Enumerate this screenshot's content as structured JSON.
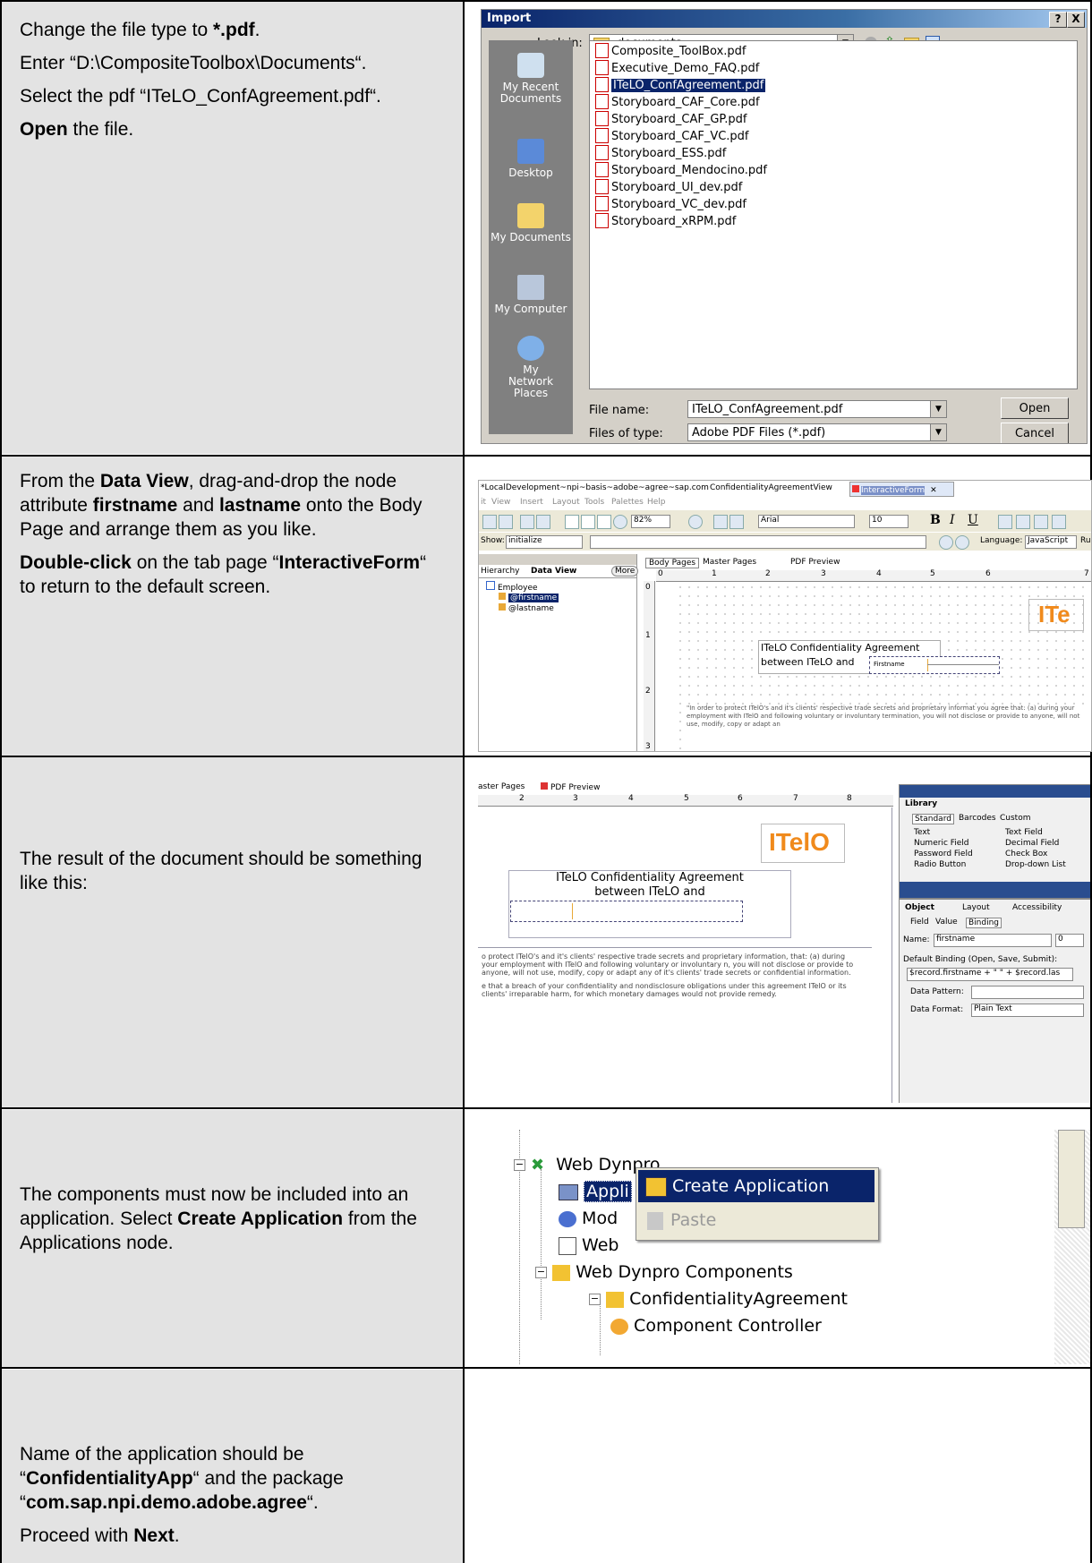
{
  "rows": [
    {
      "paragraphs": [
        [
          {
            "t": "Change the file type to "
          },
          {
            "t": "*.pdf",
            "b": true
          },
          {
            "t": "."
          }
        ],
        [
          {
            "t": "Enter “D:\\CompositeToolbox\\Documents“."
          }
        ],
        [
          {
            "t": "Select the pdf “ITeLO_ConfAgreement.pdf“."
          }
        ],
        [
          {
            "t": "Open",
            "b": true
          },
          {
            "t": " the file."
          }
        ]
      ]
    },
    {
      "paragraphs": [
        [
          {
            "t": "From the "
          },
          {
            "t": "Data View",
            "b": true
          },
          {
            "t": ", drag-and-drop the node attribute "
          },
          {
            "t": "firstname",
            "b": true
          },
          {
            "t": " and "
          },
          {
            "t": "lastname",
            "b": true
          },
          {
            "t": " onto the Body Page and arrange them as you like."
          }
        ],
        [
          {
            "t": "Double-click",
            "b": true
          },
          {
            "t": " on the tab page “"
          },
          {
            "t": "InteractiveForm",
            "b": true
          },
          {
            "t": "“ to return to the default screen."
          }
        ]
      ]
    },
    {
      "paragraphs": [
        [
          {
            "t": "The result of the document should be something like this:"
          }
        ]
      ]
    },
    {
      "paragraphs": [
        [
          {
            "t": "The components must now be included into an application. Select "
          },
          {
            "t": "Create Application",
            "b": true
          },
          {
            "t": " from the Applications node."
          }
        ]
      ]
    },
    {
      "paragraphs": [
        [
          {
            "t": "Name of the application should be “"
          },
          {
            "t": "ConfidentialityApp",
            "b": true
          },
          {
            "t": "“ and the package “"
          },
          {
            "t": "com.sap.npi.demo.adobe.agree",
            "b": true
          },
          {
            "t": "“."
          }
        ],
        [
          {
            "t": "Proceed with "
          },
          {
            "t": "Next",
            "b": true
          },
          {
            "t": "."
          }
        ]
      ]
    }
  ],
  "import_dialog": {
    "title": "Import",
    "title_buttons": [
      "?",
      "X"
    ],
    "look_in_label": "Look in:",
    "look_in_value": "documents",
    "places": [
      "My Recent Documents",
      "Desktop",
      "My Documents",
      "My Computer",
      "My Network Places"
    ],
    "files": [
      "Composite_ToolBox.pdf",
      "Executive_Demo_FAQ.pdf",
      "ITeLO_ConfAgreement.pdf",
      "Storyboard_CAF_Core.pdf",
      "Storyboard_CAF_GP.pdf",
      "Storyboard_CAF_VC.pdf",
      "Storyboard_ESS.pdf",
      "Storyboard_Mendocino.pdf",
      "Storyboard_UI_dev.pdf",
      "Storyboard_VC_dev.pdf",
      "Storyboard_xRPM.pdf"
    ],
    "selected_file": "ITeLO_ConfAgreement.pdf",
    "file_name_label": "File name:",
    "file_name_value": "ITeLO_ConfAgreement.pdf",
    "files_of_type_label": "Files of type:",
    "files_of_type_value": "Adobe PDF Files (*.pdf)",
    "open_button": "Open",
    "cancel_button": "Cancel"
  },
  "designer1": {
    "tabs": [
      "*LocalDevelopment~npi~basis~adobe~agree~sap.com",
      "ConfidentialityAgreementView",
      "InteractiveForm"
    ],
    "menu": [
      "it",
      "View",
      "Insert",
      "Layout",
      "Tools",
      "Palettes",
      "Help"
    ],
    "zoom": "82%",
    "font": "Arial",
    "font_size": "10",
    "show_label": "Show:",
    "show_value": "initialize",
    "language_label": "Language:",
    "language_value": "JavaScript",
    "language_extra": "Ru",
    "panel_tabs": [
      "Hierarchy",
      "Data View",
      "More"
    ],
    "tree": [
      "Employee",
      "@firstname",
      "@lastname"
    ],
    "page_tabs": [
      "Body Pages",
      "Master Pages",
      "PDF Preview"
    ],
    "ruler_top": [
      "0",
      "1",
      "2",
      "3",
      "4",
      "5",
      "6",
      "7"
    ],
    "ruler_left": [
      "0",
      "1",
      "2",
      "3"
    ],
    "logo": "ITe",
    "heading_line1": "ITeLO Confidentiality Agreement",
    "heading_line2": "between ITeLO and",
    "field_label": "Firstname",
    "body_text": "\"In order to protect ITelO's and it's clients' respective trade secrets and proprietary informat you agree that: (a) during your employment with ITelO and following voluntary or involuntary termination, you will not disclose or provide to anyone, will not use, modify, copy or adapt an"
  },
  "designer2": {
    "page_tabs": [
      "aster Pages",
      "PDF Preview"
    ],
    "ruler_top": [
      "2",
      "3",
      "4",
      "5",
      "6",
      "7",
      "8"
    ],
    "logo": "ITelO",
    "heading_line1": "ITeLO Confidentiality Agreement",
    "heading_line2": "between ITeLO and",
    "body_text1": "o protect ITelO's and it's clients' respective trade secrets and proprietary information, that: (a) during your employment with ITelO and following voluntary or involuntary n, you will not disclose or provide to anyone, will not use, modify, copy or adapt any of it's clients' trade secrets or confidential information.",
    "body_text2": "e that a breach of your confidentiality and nondisclosure obligations under this agreement ITelO or its clients' irreparable harm, for which monetary damages would not provide remedy.",
    "library_title": "Library",
    "library_tabs": [
      "Standard",
      "Barcodes",
      "Custom"
    ],
    "library_items": [
      "Text",
      "Text Field",
      "Numeric Field",
      "Decimal Field",
      "Password Field",
      "Check Box",
      "Radio Button",
      "Drop-down List"
    ],
    "object_tabs": [
      "Object",
      "Layout",
      "Accessibility"
    ],
    "object_subtabs": [
      "Field",
      "Value",
      "Binding"
    ],
    "name_label": "Name:",
    "name_value": "firstname",
    "name_index": "0",
    "default_binding_label": "Default Binding (Open, Save, Submit):",
    "default_binding_value": "$record.firstname + \" \" + $record.las",
    "data_pattern_label": "Data Pattern:",
    "data_format_label": "Data Format:",
    "data_format_value": "Plain Text"
  },
  "context_menu_shot": {
    "tree": [
      "Web Dynpro",
      "Appli",
      "Mod",
      "Web",
      "Web Dynpro Components",
      "ConfidentialityAgreement",
      "Component Controller"
    ],
    "menu": [
      "Create Application",
      "Paste"
    ]
  }
}
